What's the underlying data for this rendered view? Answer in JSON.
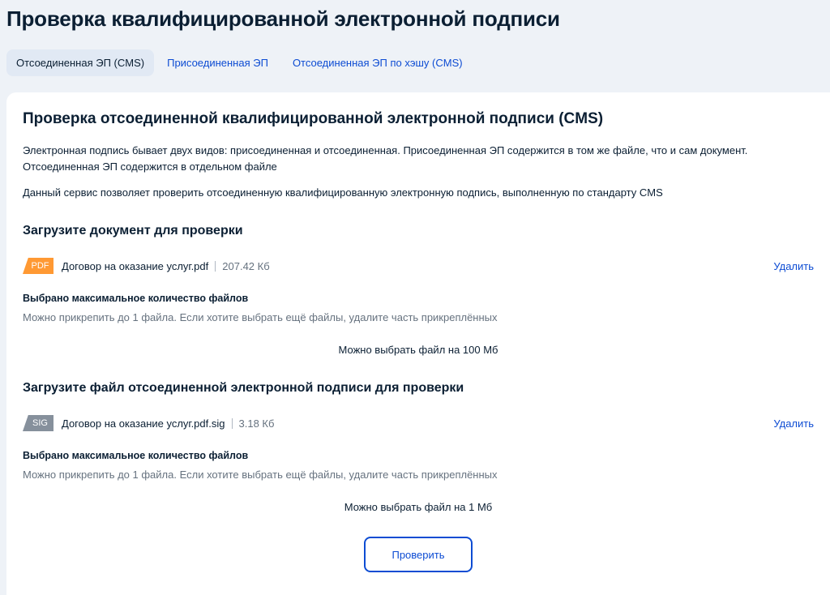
{
  "page": {
    "title": "Проверка квалифицированной электронной подписи"
  },
  "tabs": [
    {
      "label": "Отсоединенная ЭП (CMS)",
      "active": true
    },
    {
      "label": "Присоединенная ЭП",
      "active": false
    },
    {
      "label": "Отсоединенная ЭП по хэшу (CMS)",
      "active": false
    }
  ],
  "card": {
    "title": "Проверка отсоединенной квалифицированной электронной подписи (CMS)",
    "desc_line1": "Электронная подпись бывает двух видов: присоединенная и отсоединенная. Присоединенная ЭП содержится в том же файле, что и сам документ.",
    "desc_line2": "Отсоединенная ЭП содержится в отдельном файле",
    "desc_service": "Данный сервис позволяет проверить отсоединенную квалифицированную электронную подпись, выполненную по стандарту CMS"
  },
  "document_upload": {
    "title": "Загрузите документ для проверки",
    "file": {
      "badge": "PDF",
      "badge_color": "#ff9933",
      "name": "Договор на оказание услуг.pdf",
      "size": "207.42 Кб",
      "delete_label": "Удалить"
    },
    "limit_title": "Выбрано максимальное количество файлов",
    "limit_hint": "Можно прикрепить до 1 файла. Если хотите выбрать ещё файлы, удалите часть прикреплённых",
    "size_note": "Можно выбрать файл на 100 Мб"
  },
  "signature_upload": {
    "title": "Загрузите файл отсоединенной электронной подписи для проверки",
    "file": {
      "badge": "SIG",
      "badge_color": "#86909c",
      "name": "Договор на оказание услуг.pdf.sig",
      "size": "3.18 Кб",
      "delete_label": "Удалить"
    },
    "limit_title": "Выбрано максимальное количество файлов",
    "limit_hint": "Можно прикрепить до 1 файла. Если хотите выбрать ещё файлы, удалите часть прикреплённых",
    "size_note": "Можно выбрать файл на 1 Мб"
  },
  "actions": {
    "verify_label": "Проверить"
  },
  "colors": {
    "accent": "#0d4cd3",
    "text": "#0b1f33",
    "muted": "#66727f",
    "background": "#eef2f7",
    "tab_active_bg": "#e1e9f4"
  }
}
